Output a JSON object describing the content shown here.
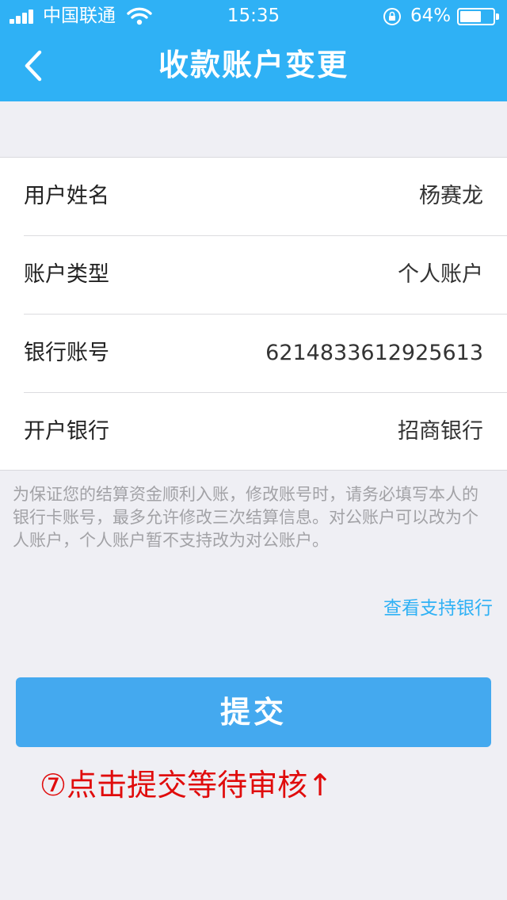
{
  "status_bar": {
    "carrier": "中国联通",
    "time": "15:35",
    "battery_percent": "64%",
    "battery_level": 0.64
  },
  "header": {
    "title": "收款账户变更",
    "background_color": "#2fb1f5"
  },
  "form": {
    "rows": [
      {
        "label": "用户姓名",
        "value": "杨赛龙"
      },
      {
        "label": "账户类型",
        "value": "个人账户"
      },
      {
        "label": "银行账号",
        "value": "6214833612925613"
      },
      {
        "label": "开户银行",
        "value": "招商银行"
      }
    ]
  },
  "notice": "为保证您的结算资金顺利入账，修改账号时，请务必填写本人的银行卡账号，最多允许修改三次结算信息。对公账户可以改为个人账户，个人账户暂不支持改为对公账户。",
  "link": {
    "label": "查看支持银行",
    "color": "#2fb1f5"
  },
  "submit": {
    "label": "提交",
    "color": "#44a9ef"
  },
  "annotation": {
    "text": "⑦点击提交等待审核↑",
    "color": "#e00c0c"
  }
}
